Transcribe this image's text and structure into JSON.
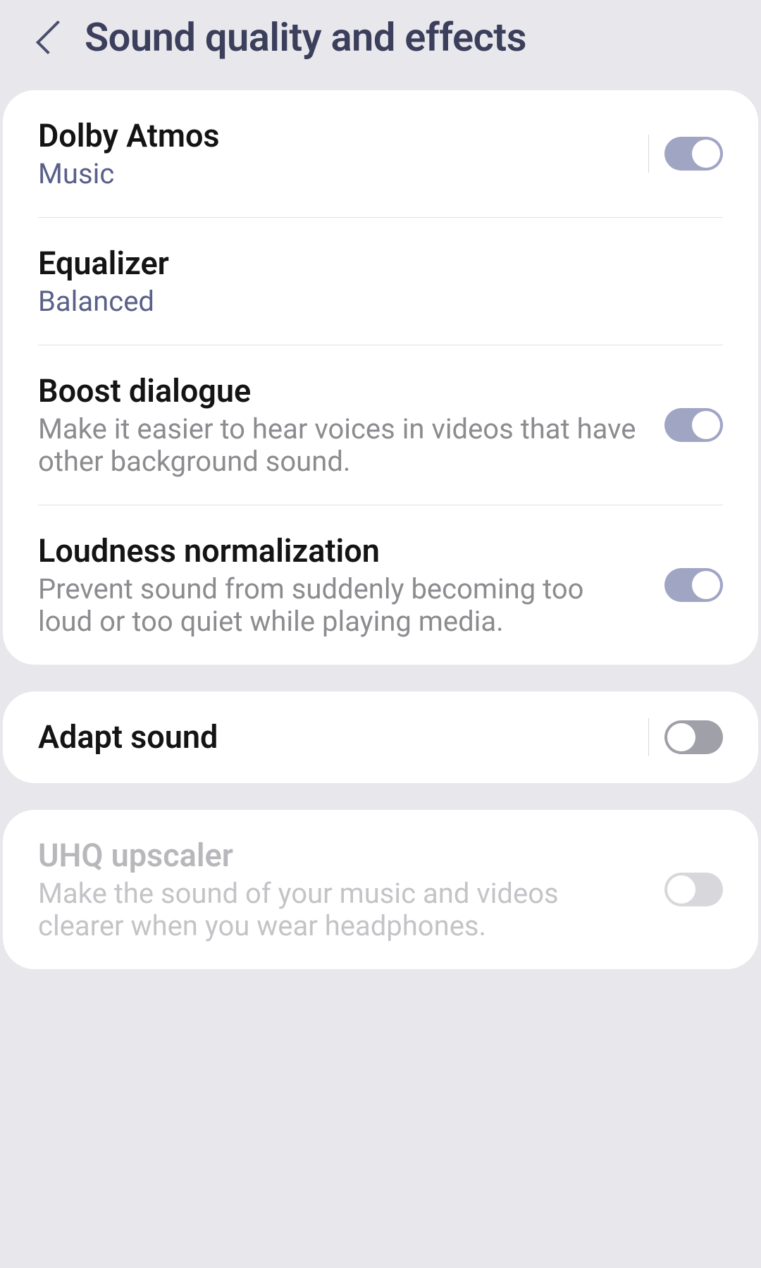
{
  "header": {
    "title": "Sound quality and effects"
  },
  "dolby": {
    "title": "Dolby Atmos",
    "subtitle": "Music"
  },
  "equalizer": {
    "title": "Equalizer",
    "subtitle": "Balanced"
  },
  "boost": {
    "title": "Boost dialogue",
    "description": "Make it easier to hear voices in videos that have other background sound."
  },
  "loudness": {
    "title": "Loudness normalization",
    "description": "Prevent sound from suddenly becoming too loud or too quiet while playing media."
  },
  "adapt": {
    "title": "Adapt sound"
  },
  "uhq": {
    "title": "UHQ upscaler",
    "description": "Make the sound of your music and videos clearer when you wear headphones."
  }
}
